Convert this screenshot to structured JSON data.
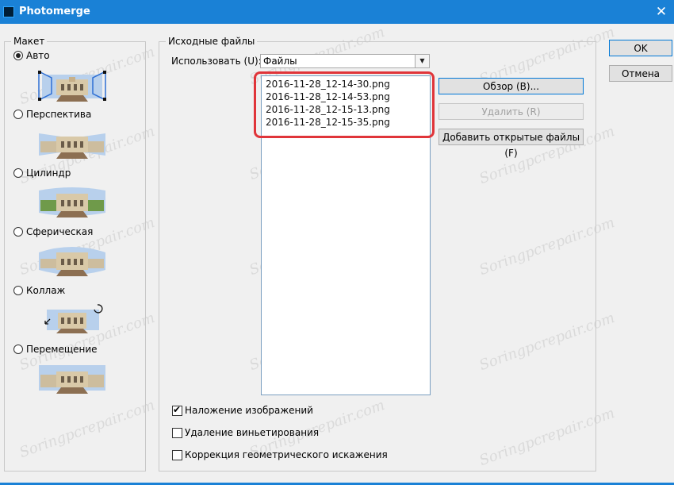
{
  "window": {
    "title": "Photomerge"
  },
  "layout_group": {
    "legend": "Макет",
    "options": [
      {
        "label": "Авто",
        "checked": true
      },
      {
        "label": "Перспектива",
        "checked": false
      },
      {
        "label": "Цилиндр",
        "checked": false
      },
      {
        "label": "Сферическая",
        "checked": false
      },
      {
        "label": "Коллаж",
        "checked": false
      },
      {
        "label": "Перемещение",
        "checked": false
      }
    ]
  },
  "source_group": {
    "legend": "Исходные файлы",
    "use_label": "Использовать (U):",
    "use_value": "Файлы",
    "files": [
      "2016-11-28_12-14-30.png",
      "2016-11-28_12-14-53.png",
      "2016-11-28_12-15-13.png",
      "2016-11-28_12-15-35.png"
    ],
    "browse_label": "Обзор (B)...",
    "remove_label": "Удалить (R)",
    "add_open_label": "Добавить открытые файлы (F)"
  },
  "checkboxes": [
    {
      "label": "Наложение изображений",
      "checked": true
    },
    {
      "label": "Удаление виньетирования",
      "checked": false
    },
    {
      "label": "Коррекция геометрического искажения",
      "checked": false
    }
  ],
  "buttons": {
    "ok": "OK",
    "cancel": "Отмена"
  },
  "watermark_text": "Soringpcrepair.com",
  "colors": {
    "titlebar": "#1a81d6",
    "highlight": "#e0353a",
    "list_border": "#7a9ec0"
  }
}
